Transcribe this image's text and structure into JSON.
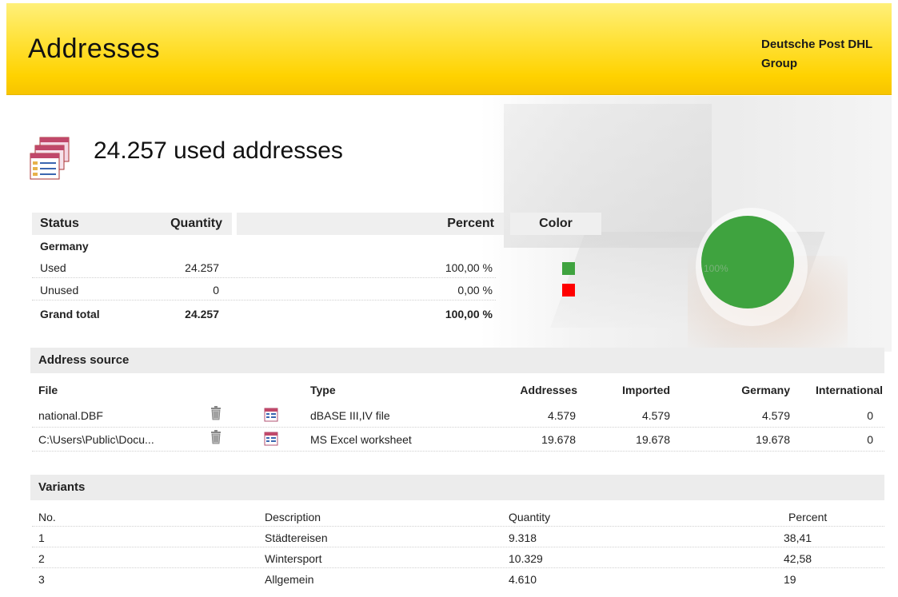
{
  "header": {
    "title": "Addresses",
    "brand": "Deutsche Post DHL Group",
    "brand_color": "#ffd200"
  },
  "summary": {
    "icon": "address-list-icon",
    "title": "24.257 used addresses"
  },
  "status_table": {
    "headers": {
      "status": "Status",
      "quantity": "Quantity",
      "percent": "Percent",
      "color": "Color"
    },
    "group": "Germany",
    "rows": [
      {
        "status": "Used",
        "quantity": "24.257",
        "percent": "100,00 %",
        "color": "#3fa33f"
      },
      {
        "status": "Unused",
        "quantity": "0",
        "percent": "0,00 %",
        "color": "#ff0000"
      }
    ],
    "total": {
      "status": "Grand total",
      "quantity": "24.257",
      "percent": "100,00 %"
    }
  },
  "chart_data": {
    "type": "pie",
    "slices": [
      {
        "label": "Used",
        "value": 100,
        "color": "#3fa33f"
      },
      {
        "label": "Unused",
        "value": 0,
        "color": "#ff0000"
      }
    ],
    "data_label": "100%"
  },
  "address_source": {
    "title": "Address source",
    "headers": {
      "file": "File",
      "type": "Type",
      "addresses": "Addresses",
      "imported": "Imported",
      "germany": "Germany",
      "international": "International"
    },
    "rows": [
      {
        "file": "national.DBF",
        "type": "dBASE III,IV file",
        "addresses": "4.579",
        "imported": "4.579",
        "germany": "4.579",
        "international": "0"
      },
      {
        "file": "C:\\Users\\Public\\Docu...",
        "type": "MS Excel worksheet",
        "addresses": "19.678",
        "imported": "19.678",
        "germany": "19.678",
        "international": "0"
      }
    ],
    "icons": {
      "delete": "trash-icon",
      "view": "table-icon"
    }
  },
  "variants": {
    "title": "Variants",
    "headers": {
      "no": "No.",
      "description": "Description",
      "quantity": "Quantity",
      "percent": "Percent"
    },
    "rows": [
      {
        "no": "1",
        "description": "Städtereisen",
        "quantity": "9.318",
        "percent": "38,41"
      },
      {
        "no": "2",
        "description": "Wintersport",
        "quantity": "10.329",
        "percent": "42,58"
      },
      {
        "no": "3",
        "description": "Allgemein",
        "quantity": "4.610",
        "percent": "19"
      }
    ]
  }
}
